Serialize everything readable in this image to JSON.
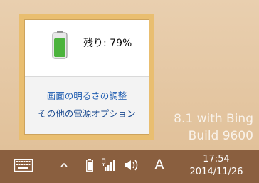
{
  "battery_flyout": {
    "status_text": "残り: 79%",
    "charge_level": 0.79,
    "links": {
      "brightness": "画面の明るさの調整",
      "power_options": "その他の電源オプション"
    }
  },
  "watermark": {
    "line1": "8.1 with Bing",
    "line2": "Build 9600"
  },
  "taskbar": {
    "ime_mode": "A",
    "clock": {
      "time": "17:54",
      "date": "2014/11/26"
    }
  },
  "colors": {
    "flyout_border": "#e9be70",
    "link": "#1c5bb0",
    "battery_fill": "#4bb33c",
    "taskbar": "#8a5f3f"
  }
}
